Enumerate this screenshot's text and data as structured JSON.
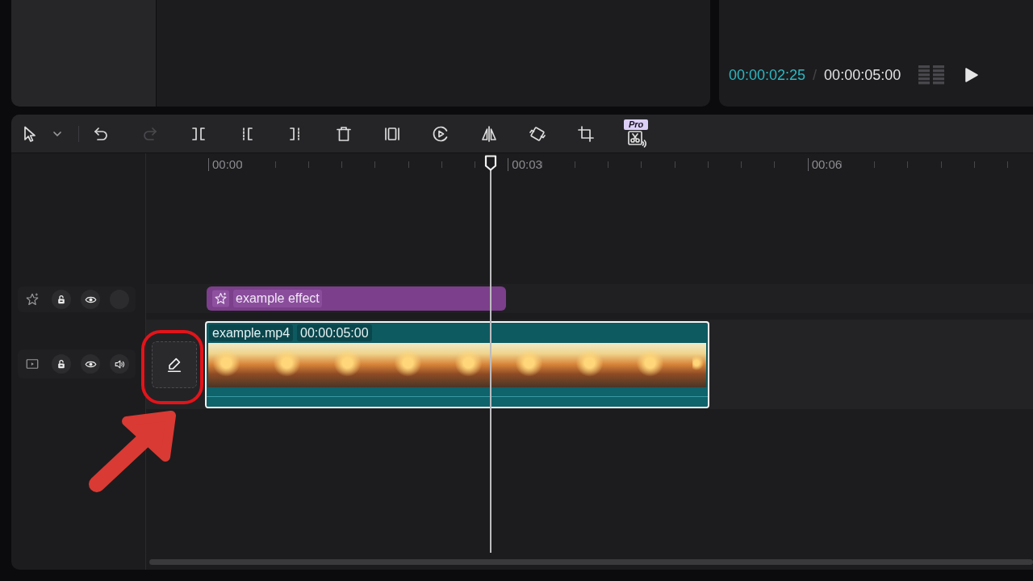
{
  "player": {
    "current_time": "00:00:02:25",
    "separator": "/",
    "total_time": "00:00:05:00"
  },
  "toolbar": {
    "undo": {
      "disabled": false
    },
    "redo": {
      "disabled": true
    },
    "pro_badge": "Pro"
  },
  "timeline": {
    "ruler_labels": [
      "00:00",
      "00:03",
      "00:06"
    ],
    "tracks": [
      {
        "kind": "effect",
        "locked": false,
        "visible": true,
        "clip": {
          "label": "example effect",
          "selected": false
        }
      },
      {
        "kind": "video",
        "locked": false,
        "visible": true,
        "muted": false,
        "clip": {
          "name": "example.mp4",
          "duration": "00:00:05:00",
          "selected": true
        }
      }
    ]
  }
}
